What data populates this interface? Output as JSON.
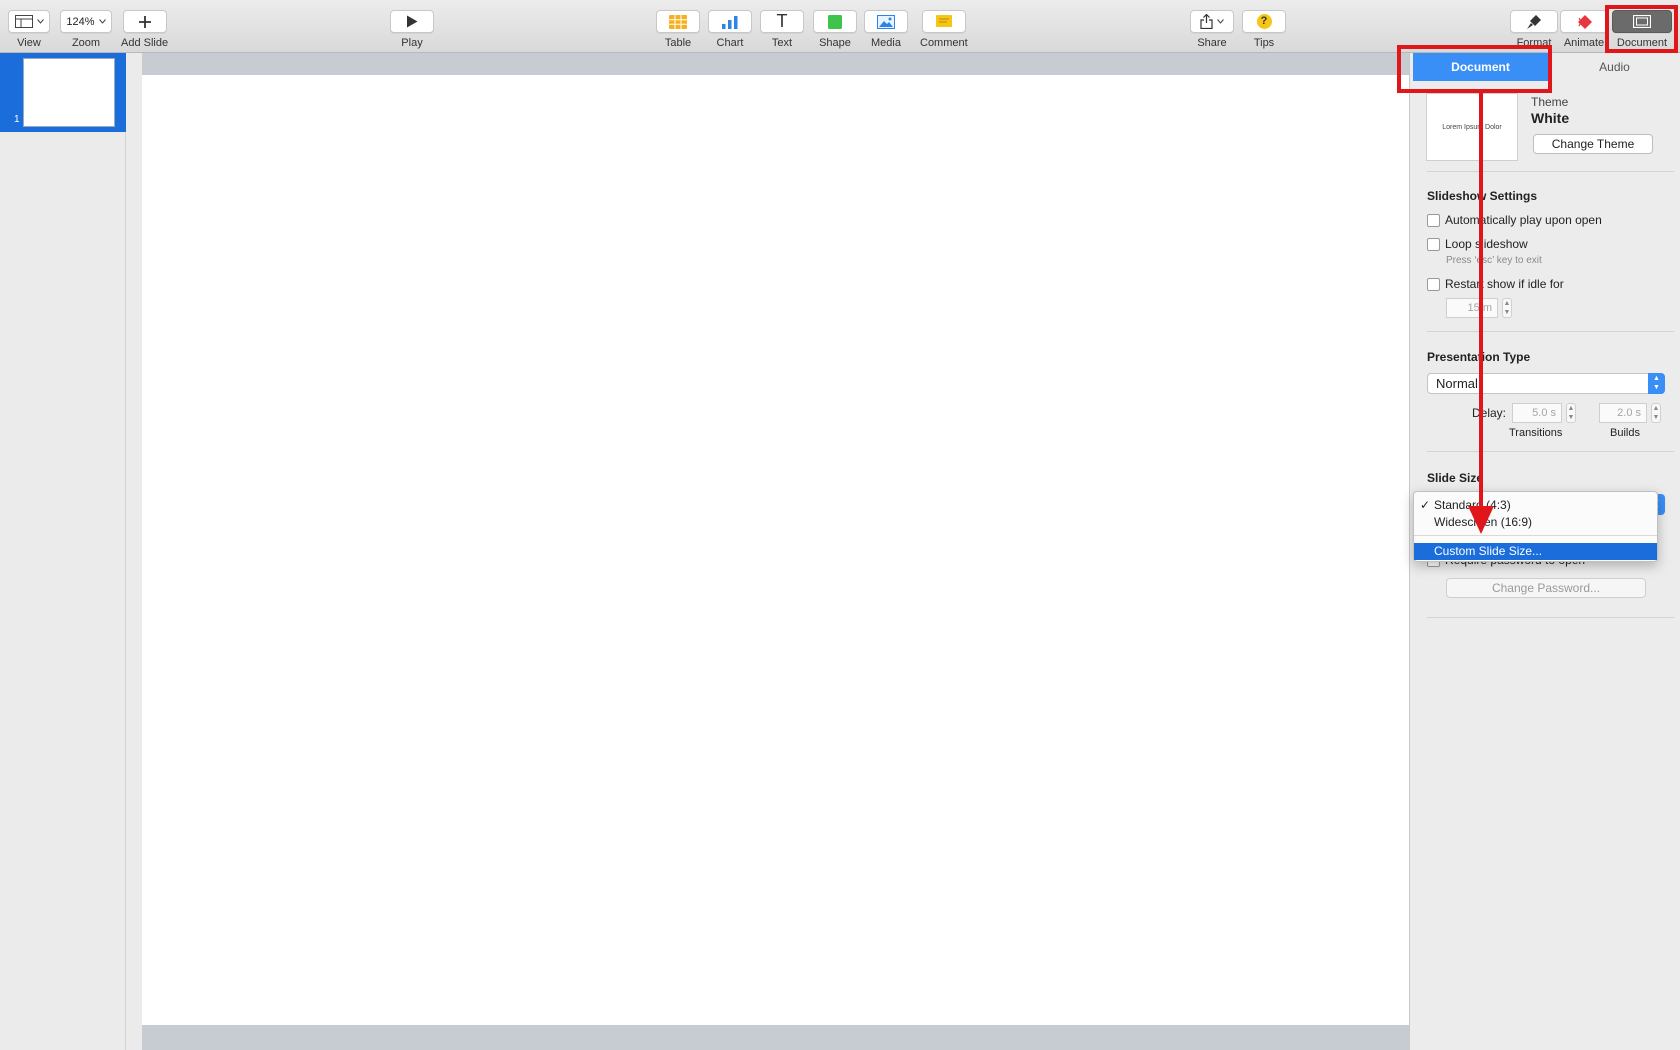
{
  "toolbar": {
    "view_label": "View",
    "zoom_value": "124%",
    "zoom_label": "Zoom",
    "add_slide_label": "Add Slide",
    "play_label": "Play",
    "table_label": "Table",
    "chart_label": "Chart",
    "text_label": "Text",
    "shape_label": "Shape",
    "media_label": "Media",
    "comment_label": "Comment",
    "share_label": "Share",
    "tips_label": "Tips",
    "format_label": "Format",
    "animate_label": "Animate",
    "document_label": "Document",
    "text_glyph": "T",
    "tips_glyph": "?"
  },
  "navigator": {
    "slides": [
      {
        "number": "1"
      }
    ]
  },
  "inspector": {
    "tabs": {
      "document": "Document",
      "audio": "Audio"
    },
    "theme": {
      "caption": "Theme",
      "name": "White",
      "thumbnail_text": "Lorem Ipsum Dolor",
      "change_button": "Change Theme"
    },
    "slideshow": {
      "heading": "Slideshow Settings",
      "auto_play": "Automatically play upon open",
      "loop": "Loop slideshow",
      "loop_hint": "Press ‘esc’ key to exit",
      "restart": "Restart show if idle for",
      "idle_value": "15 m"
    },
    "presentation": {
      "heading": "Presentation Type",
      "type_value": "Normal",
      "delay_label": "Delay:",
      "transitions_value": "5.0 s",
      "transitions_label": "Transitions",
      "builds_value": "2.0 s",
      "builds_label": "Builds"
    },
    "slide_size": {
      "heading": "Slide Size",
      "options": [
        "Standard (4:3)",
        "Widescreen (16:9)",
        "Custom Slide Size..."
      ],
      "checkmark": "✓"
    },
    "password": {
      "require_label": "Require password to open",
      "change_button": "Change Password..."
    }
  },
  "colors": {
    "annotation_red": "#e0161b",
    "selection_blue": "#1a6ddb",
    "tab_blue": "#3a8ff7"
  }
}
